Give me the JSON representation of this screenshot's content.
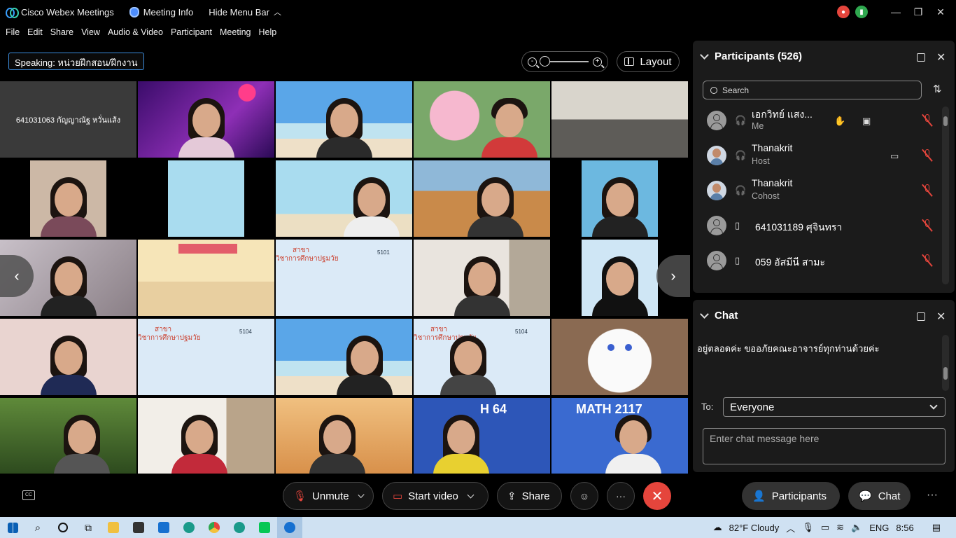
{
  "titlebar": {
    "app_name": "Cisco Webex Meetings",
    "meeting_info": "Meeting Info",
    "hide_menu": "Hide Menu Bar"
  },
  "menubar": [
    "File",
    "Edit",
    "Share",
    "View",
    "Audio & Video",
    "Participant",
    "Meeting",
    "Help"
  ],
  "speaking": "Speaking: หน่วยฝึกสอน/ฝึกงาน",
  "layout_label": "Layout",
  "tile_name_first": "641031063 กัญญาณัฐ หวั่นแส้ง",
  "participants_panel": {
    "title": "Participants (526)",
    "search_placeholder": "Search",
    "rows": [
      {
        "name": "เอกวิทย์ แสง...",
        "role": "Me"
      },
      {
        "name": "Thanakrit",
        "role": "Host"
      },
      {
        "name": "Thanakrit",
        "role": "Cohost"
      },
      {
        "name": "641031189 ศุจินทรา",
        "role": ""
      },
      {
        "name": "059 อัสมีนี สามะ",
        "role": ""
      }
    ]
  },
  "chat_panel": {
    "title": "Chat",
    "message": "อยู่ตลอดค่ะ ขออภัยคณะอาจารย์ทุกท่านด้วยค่ะ",
    "to_label": "To:",
    "to_value": "Everyone",
    "input_placeholder": "Enter chat message here"
  },
  "controls": {
    "unmute": "Unmute",
    "start_video": "Start video",
    "share": "Share",
    "participants": "Participants",
    "chat": "Chat"
  },
  "tile_text": {
    "sakha": "สาขา",
    "program": "วิชาการศึกษาปฐมวัย",
    "room": "5104",
    "room2": "5101",
    "math64": "H 64",
    "math2117": "MATH 2117"
  },
  "taskbar": {
    "weather": "82°F  Cloudy",
    "lang": "ENG",
    "time": "8:56"
  },
  "colors": {
    "accent": "#3c8dde",
    "danger": "#e5453c",
    "panel": "#1b1b1b"
  }
}
